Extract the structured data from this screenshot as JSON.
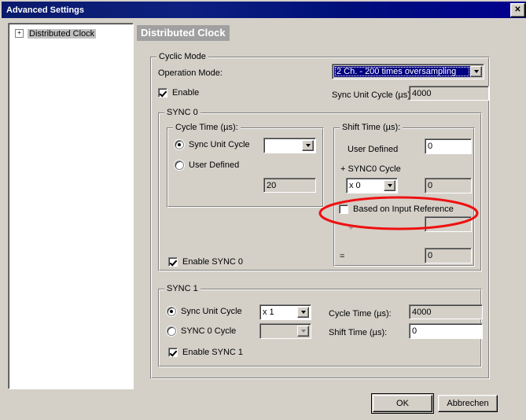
{
  "window": {
    "title": "Advanced Settings",
    "close_icon": "close-icon",
    "close_glyph": "✕"
  },
  "tree": {
    "items": [
      {
        "label": "Distributed Clock",
        "expander": "+",
        "selected": true
      }
    ]
  },
  "pane": {
    "header": "Distributed Clock"
  },
  "cyclic_mode": {
    "title": "Cyclic Mode",
    "operation_mode_label": "Operation Mode:",
    "operation_mode_value": "2 Ch. - 200 times oversampling",
    "operation_mode_options": [
      "2 Ch. - 200 times oversampling"
    ],
    "enable_label": "Enable",
    "enable_checked": true,
    "sync_unit_cycle_label": "Sync Unit Cycle (µs):",
    "sync_unit_cycle_value": "4000"
  },
  "sync0": {
    "title": "SYNC 0",
    "cycle_time": {
      "title": "Cycle Time (µs):",
      "sync_unit_cycle_label": "Sync Unit Cycle",
      "sync_unit_cycle_selected": true,
      "sync_unit_cycle_combo_value": "",
      "user_defined_label": "User Defined",
      "user_defined_selected": false,
      "user_defined_value": "20"
    },
    "shift_time": {
      "title": "Shift Time (µs):",
      "user_defined_label": "User Defined",
      "user_defined_value": "0",
      "sync0_cycle_label": "+ SYNC0 Cycle",
      "multiplier_value": "x 0",
      "multiplier_options": [
        "x 0"
      ],
      "multiplier_result": "0",
      "based_on_input_reference_label": "Based on Input Reference",
      "based_on_input_reference_checked": false,
      "plus_label": "+",
      "plus_value": "",
      "equals_label": "=",
      "equals_value": "0"
    },
    "enable_label": "Enable SYNC 0",
    "enable_checked": true
  },
  "sync1": {
    "title": "SYNC 1",
    "sync_unit_cycle_label": "Sync Unit Cycle",
    "sync_unit_cycle_selected": true,
    "sync_unit_cycle_combo_value": "x 1",
    "sync_unit_cycle_combo_options": [
      "x 1"
    ],
    "sync0_cycle_label": "SYNC 0 Cycle",
    "sync0_cycle_selected": false,
    "sync0_cycle_combo_value": "",
    "cycle_time_label": "Cycle Time (µs):",
    "cycle_time_value": "4000",
    "shift_time_label": "Shift Time (µs):",
    "shift_time_value": "0",
    "enable_label": "Enable SYNC 1",
    "enable_checked": true
  },
  "footer": {
    "ok_label": "OK",
    "cancel_label": "Abbrechen"
  },
  "annotation": {
    "shape": "ellipse",
    "color": "#ee1111",
    "target": "Based on Input Reference"
  },
  "colors": {
    "titlebar_start": "#0a1a6b",
    "titlebar_end": "#00008f",
    "dialog_face": "#d4d0c8",
    "selection_blue": "#000080",
    "pane_header_bg": "#a0a0a0",
    "annotation_red": "#ee1111"
  }
}
